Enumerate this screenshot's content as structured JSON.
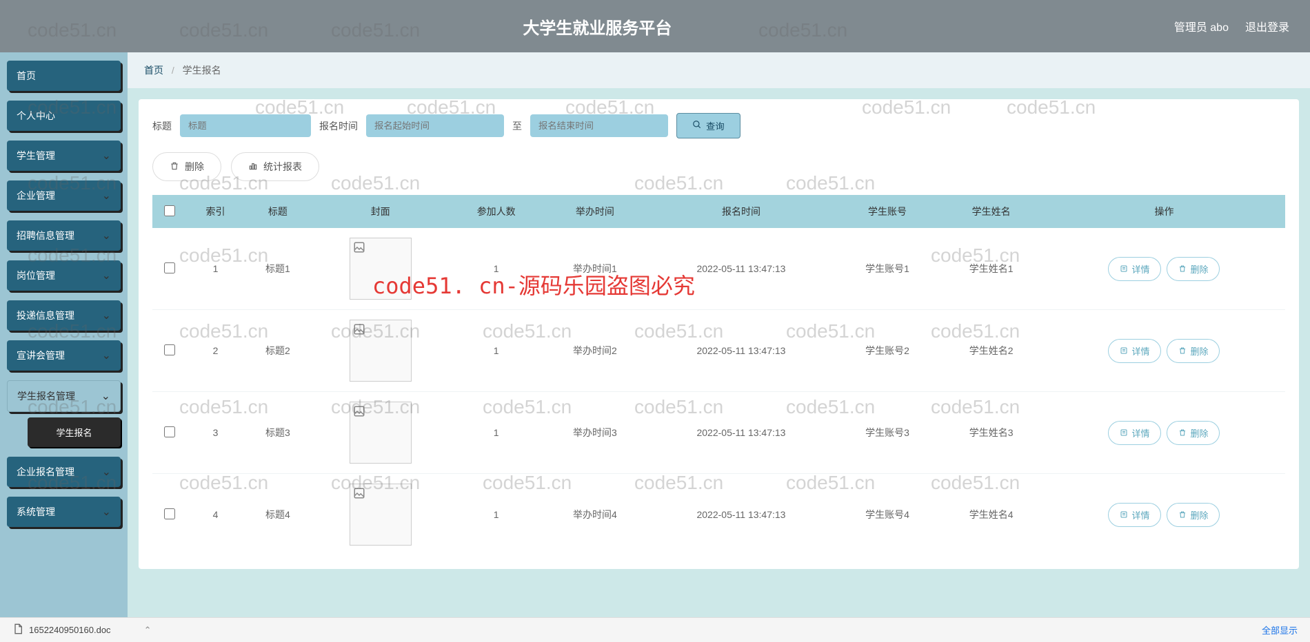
{
  "header": {
    "title": "大学生就业服务平台",
    "admin": "管理员 abo",
    "logout": "退出登录"
  },
  "sidebar": {
    "items": [
      {
        "label": "首页",
        "chevron": false
      },
      {
        "label": "个人中心",
        "chevron": false
      },
      {
        "label": "学生管理",
        "chevron": true
      },
      {
        "label": "企业管理",
        "chevron": true
      },
      {
        "label": "招聘信息管理",
        "chevron": true
      },
      {
        "label": "岗位管理",
        "chevron": true
      },
      {
        "label": "投递信息管理",
        "chevron": true
      },
      {
        "label": "宣讲会管理",
        "chevron": true
      },
      {
        "label": "学生报名管理",
        "chevron": true,
        "active": true,
        "sub": "学生报名"
      },
      {
        "label": "企业报名管理",
        "chevron": true
      },
      {
        "label": "系统管理",
        "chevron": true
      }
    ]
  },
  "breadcrumb": {
    "home": "首页",
    "current": "学生报名"
  },
  "search": {
    "title_label": "标题",
    "title_placeholder": "标题",
    "time_label": "报名时间",
    "date_from_placeholder": "报名起始时间",
    "to": "至",
    "date_to_placeholder": "报名结束时间",
    "query": "查询"
  },
  "actions": {
    "delete": "删除",
    "report": "统计报表"
  },
  "table": {
    "headers": [
      "索引",
      "标题",
      "封面",
      "参加人数",
      "举办时间",
      "报名时间",
      "学生账号",
      "学生姓名",
      "操作"
    ],
    "detail_btn": "详情",
    "delete_btn": "删除",
    "rows": [
      {
        "idx": "1",
        "title": "标题1",
        "count": "1",
        "hold": "举办时间1",
        "signup": "2022-05-11 13:47:13",
        "account": "学生账号1",
        "name": "学生姓名1"
      },
      {
        "idx": "2",
        "title": "标题2",
        "count": "1",
        "hold": "举办时间2",
        "signup": "2022-05-11 13:47:13",
        "account": "学生账号2",
        "name": "学生姓名2"
      },
      {
        "idx": "3",
        "title": "标题3",
        "count": "1",
        "hold": "举办时间3",
        "signup": "2022-05-11 13:47:13",
        "account": "学生账号3",
        "name": "学生姓名3"
      },
      {
        "idx": "4",
        "title": "标题4",
        "count": "1",
        "hold": "举办时间4",
        "signup": "2022-05-11 13:47:13",
        "account": "学生账号4",
        "name": "学生姓名4"
      }
    ]
  },
  "download_bar": {
    "file": "1652240950160.doc",
    "show_all": "全部显示"
  },
  "watermark": {
    "text": "code51.cn",
    "red": "code51. cn-源码乐园盗图必究"
  }
}
